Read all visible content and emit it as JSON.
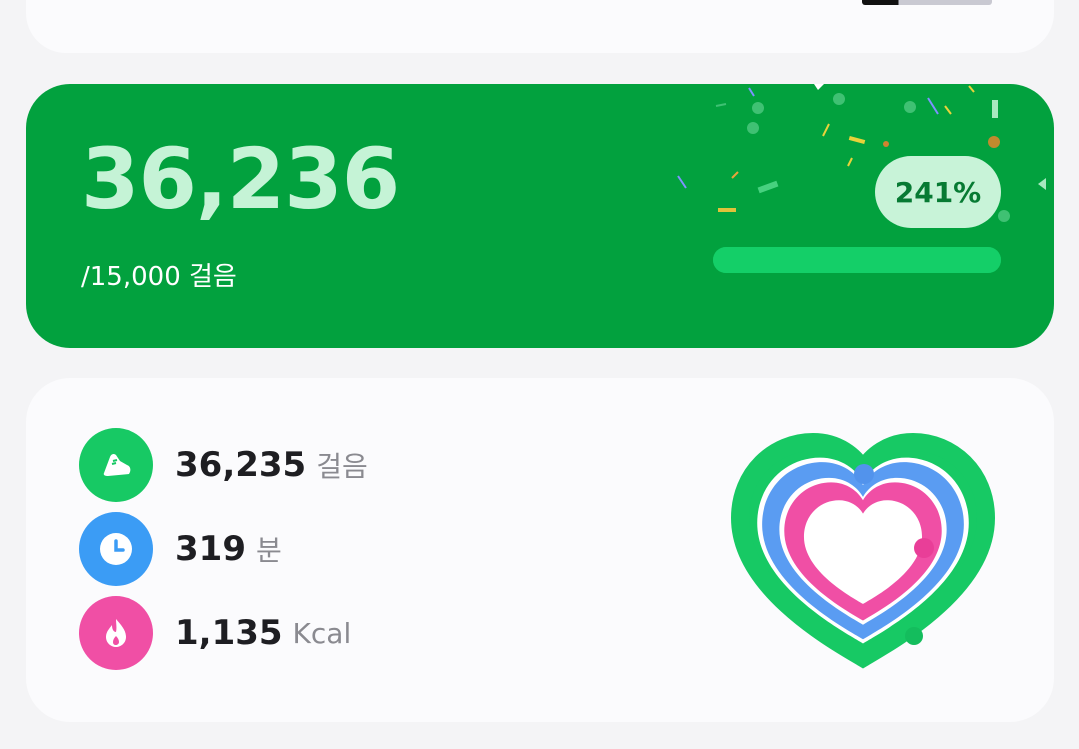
{
  "steps_card": {
    "steps": "36,236",
    "goal": "/15,000 걸음",
    "percent_label": "241%",
    "progress_fraction": 1.0
  },
  "stats": [
    {
      "icon": "shoe-icon",
      "value": "36,235",
      "unit": "걸음",
      "color": "#17c964"
    },
    {
      "icon": "clock-icon",
      "value": "319",
      "unit": "분",
      "color": "#3b9cf5"
    },
    {
      "icon": "flame-icon",
      "value": "1,135",
      "unit": "Kcal",
      "color": "#f04fa5"
    }
  ],
  "colors": {
    "card_green": "#02a13e",
    "ring_green": "#17c964",
    "ring_blue": "#5a9cf2",
    "ring_pink": "#f04fa5"
  }
}
